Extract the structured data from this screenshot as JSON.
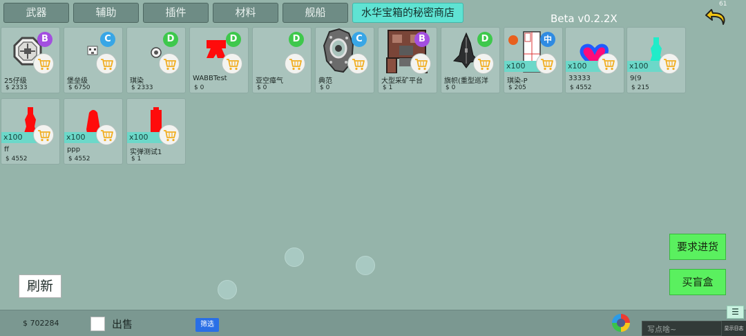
{
  "tabs": [
    {
      "label": "武器",
      "active": false
    },
    {
      "label": "辅助",
      "active": false
    },
    {
      "label": "插件",
      "active": false
    },
    {
      "label": "材料",
      "active": false
    },
    {
      "label": "舰船",
      "active": false
    },
    {
      "label": "水华宝箱的秘密商店",
      "active": true
    }
  ],
  "version": "Beta v0.2.2X",
  "fps": "61",
  "items": [
    {
      "name": "25仔级",
      "price": "$ 2333",
      "badge": "B",
      "qty": "",
      "icon": "octagon-ship-icon"
    },
    {
      "name": "堡垒级",
      "price": "$ 6750",
      "badge": "C",
      "qty": "",
      "icon": "small-fortress-icon"
    },
    {
      "name": "琪染",
      "price": "$ 2333",
      "badge": "D",
      "qty": "",
      "icon": "tiny-ship-icon"
    },
    {
      "name": "WABBTest",
      "price": "$ 0",
      "badge": "D",
      "qty": "",
      "icon": "red-shape-icon"
    },
    {
      "name": "亚空瘴气",
      "price": "$ 0",
      "badge": "D",
      "qty": "",
      "icon": "empty-icon"
    },
    {
      "name": "典范",
      "price": "$ 0",
      "badge": "C",
      "qty": "",
      "icon": "stone-ring-ship-icon"
    },
    {
      "name": "大型采矿平台",
      "price": "$ 1",
      "badge": "B",
      "qty": "",
      "icon": "mining-platform-icon"
    },
    {
      "name": "旗帜(重型巡洋",
      "price": "$ 0",
      "badge": "D",
      "qty": "",
      "icon": "dark-cruiser-icon"
    },
    {
      "name": "琪染-P",
      "price": "$ 205",
      "badge": "中",
      "qty": "x100",
      "icon": "plugin-panel-icon"
    },
    {
      "name": "33333",
      "price": "$ 4552",
      "badge": "",
      "qty": "x100",
      "icon": "heart-icon"
    },
    {
      "name": "9(9",
      "price": "$ 215",
      "badge": "",
      "qty": "x100",
      "icon": "cyan-vase-icon"
    },
    {
      "name": "ff",
      "price": "$ 4552",
      "badge": "",
      "qty": "x100",
      "icon": "red-vase-icon"
    },
    {
      "name": "ppp",
      "price": "$ 4552",
      "badge": "",
      "qty": "x100",
      "icon": "red-drop-icon"
    },
    {
      "name": "实弹测试1",
      "price": "$ 1",
      "badge": "",
      "qty": "x100",
      "icon": "red-block-icon"
    }
  ],
  "buttons": {
    "refresh": "刷新",
    "request_restock": "要求进货",
    "blind_box": "买盲盒"
  },
  "bottom": {
    "money": "$ 702284",
    "sell_label": "出售",
    "sell_checked": false,
    "filter_label": "筛选",
    "chat_placeholder": "写点啥~",
    "show_log": "显示日志",
    "menu_glyph": "☰"
  },
  "colors": {
    "background": "#95b4aa",
    "active_tab": "#5fe3d3",
    "green_button": "#5af05f",
    "badge_b": "#a34fe0",
    "badge_c": "#38a6e6",
    "badge_d": "#3ec84c"
  }
}
